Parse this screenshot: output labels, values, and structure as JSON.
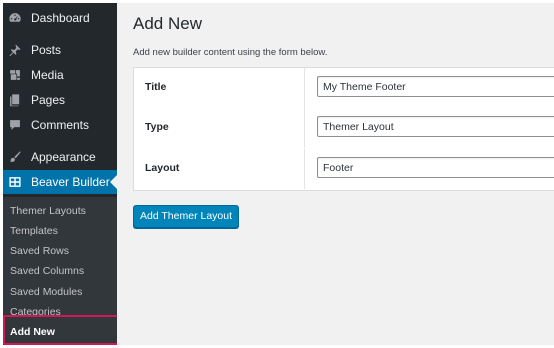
{
  "sidebar": {
    "items": [
      {
        "label": "Dashboard",
        "icon": "dashboard-icon"
      },
      {
        "label": "Posts",
        "icon": "pin-icon"
      },
      {
        "label": "Media",
        "icon": "media-icon"
      },
      {
        "label": "Pages",
        "icon": "pages-icon"
      },
      {
        "label": "Comments",
        "icon": "comment-icon"
      },
      {
        "label": "Appearance",
        "icon": "brush-icon"
      },
      {
        "label": "Beaver Builder",
        "icon": "grid-icon",
        "active": true
      }
    ],
    "submenu": [
      {
        "label": "Themer Layouts"
      },
      {
        "label": "Templates"
      },
      {
        "label": "Saved Rows"
      },
      {
        "label": "Saved Columns"
      },
      {
        "label": "Saved Modules"
      },
      {
        "label": "Categories"
      },
      {
        "label": "Add New",
        "current": true
      }
    ]
  },
  "main": {
    "title": "Add New",
    "description": "Add new builder content using the form below.",
    "form": {
      "rows": [
        {
          "label": "Title",
          "value": "My Theme Footer"
        },
        {
          "label": "Type",
          "value": "Themer Layout"
        },
        {
          "label": "Layout",
          "value": "Footer"
        }
      ]
    },
    "submit_label": "Add Themer Layout"
  },
  "colors": {
    "sidebar_bg": "#23282d",
    "submenu_bg": "#32373c",
    "active_bg": "#0073aa",
    "button_bg": "#0085ba",
    "highlight": "#d11857"
  }
}
